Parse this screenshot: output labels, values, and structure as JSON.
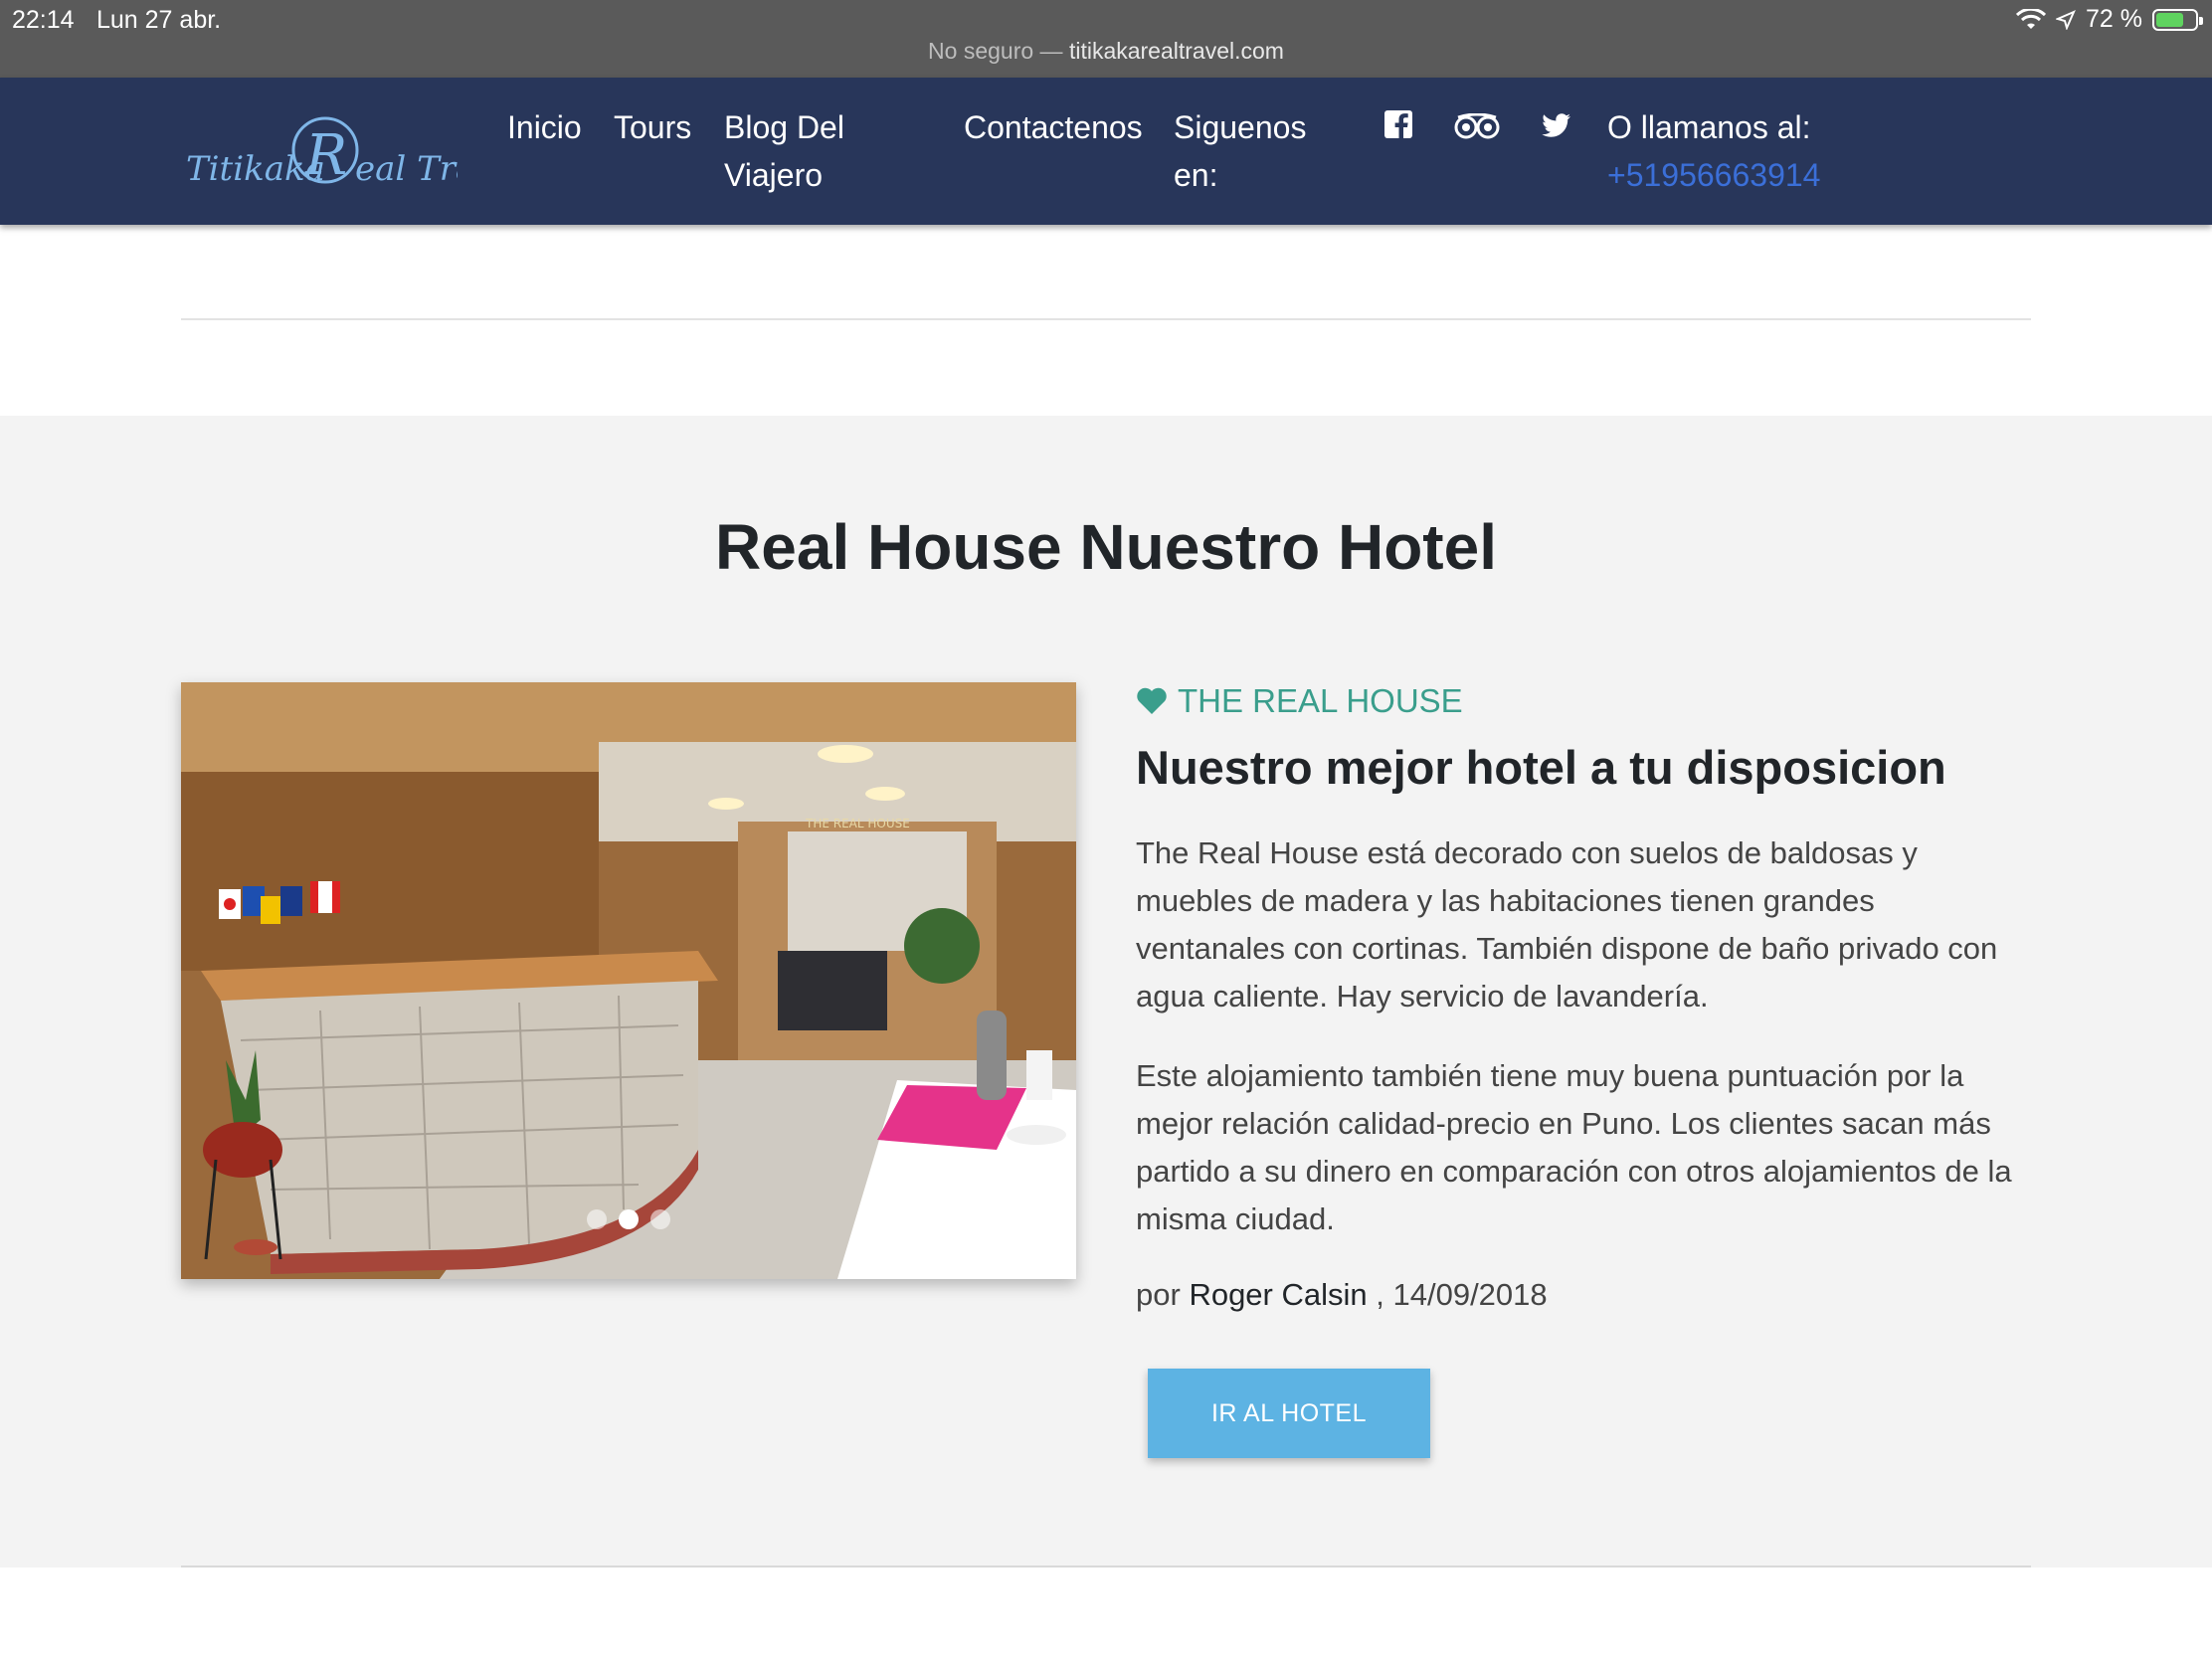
{
  "status_bar": {
    "time": "22:14",
    "date": "Lun 27 abr.",
    "battery": "72 %",
    "battery_level": 0.72
  },
  "browser": {
    "security": "No seguro —",
    "url": "titikakarealtravel.com"
  },
  "nav": {
    "logo_text_left": "Titikaka",
    "logo_text_right": "eal Travel",
    "logo_letter": "R",
    "items": [
      "Inicio",
      "Tours",
      "Blog Del",
      "Viajero",
      "Contactenos",
      "Siguenos",
      "en:"
    ],
    "call_label": "O llamanos al:",
    "phone": "+51956663914",
    "social_icons": [
      "facebook-icon",
      "tripadvisor-icon",
      "twitter-icon"
    ]
  },
  "section": {
    "title": "Real House Nuestro Hotel",
    "kicker": "THE REAL HOUSE",
    "post_title": "Nuestro mejor hotel a tu disposicion",
    "paragraphs": [
      "The Real House está decorado con suelos de baldosas y muebles de madera y las habitaciones tienen grandes ventanales con cortinas. También dispone de baño privado con agua caliente. Hay servicio de lavandería.",
      "Este alojamiento también tiene muy buena puntuación por la mejor relación calidad-precio en Puno. Los clientes sacan más partido a su dinero en comparación con otros alojamientos de la misma ciudad."
    ],
    "by": "por",
    "author": "Roger Calsin",
    "date": ", 14/09/2018",
    "button": "IR AL HOTEL",
    "photo_sign": "THE REAL HOUSE",
    "carousel_active": 2,
    "carousel_count": 3
  },
  "colors": {
    "navbar": "#28365a",
    "accent": "#3a9e8c",
    "button": "#5db3e3",
    "phone": "#3b6fd8"
  }
}
